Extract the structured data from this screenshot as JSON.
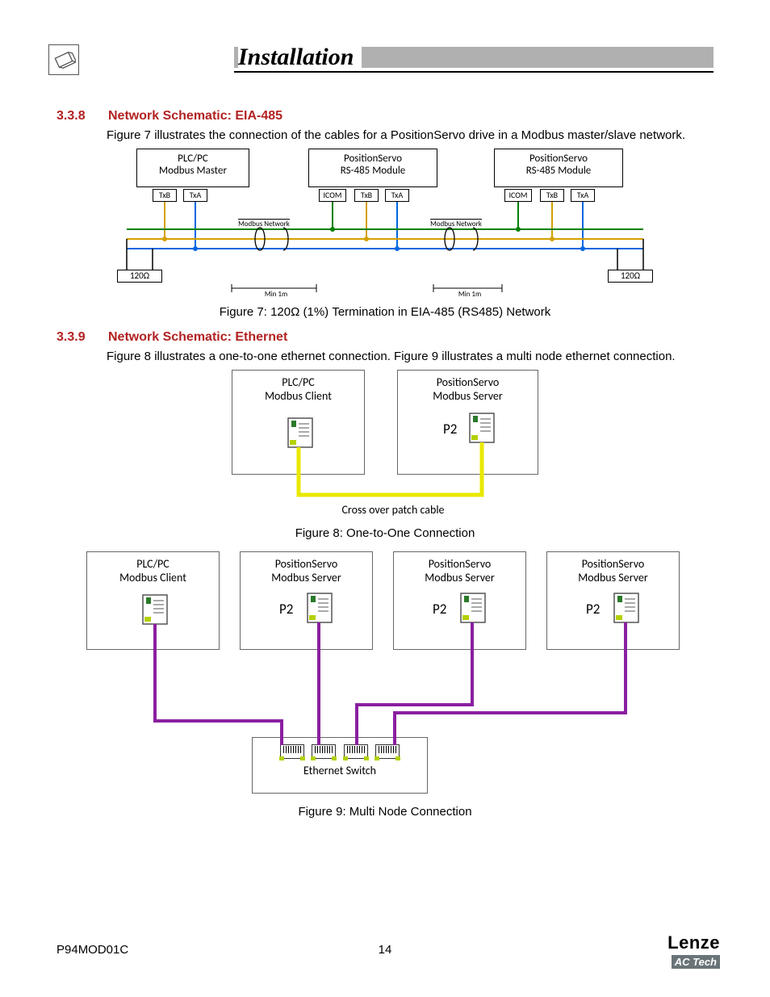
{
  "chapter_title": "Installation",
  "section_338": {
    "num": "3.3.8",
    "title": "Network Schematic: EIA-485",
    "text": "Figure 7 illustrates the connection of the cables for a PositionServo drive in a Modbus master/slave network."
  },
  "section_339": {
    "num": "3.3.9",
    "title": "Network Schematic: Ethernet",
    "text": "Figure 8 illustrates a one-to-one ethernet connection. Figure 9 illustrates a multi node ethernet connection."
  },
  "fig7": {
    "caption": "Figure 7: 120Ω (1%) Termination in EIA-485 (RS485) Network",
    "master": {
      "line1": "PLC/PC",
      "line2": "Modbus Master",
      "pins": [
        "TxB",
        "TxA"
      ]
    },
    "node": {
      "line1": "PositionServo",
      "line2": "RS-485 Module",
      "pins": [
        "ICOM",
        "TxB",
        "TxA"
      ]
    },
    "term": "120Ω",
    "bus_label": "Modbus Network",
    "min_label": "Min 1m"
  },
  "fig8": {
    "caption": "Figure 8: One-to-One Connection",
    "client": {
      "line1": "PLC/PC",
      "line2": "Modbus Client"
    },
    "server": {
      "line1": "PositionServo",
      "line2": "Modbus Server",
      "port": "P2"
    },
    "cable_label": "Cross over patch cable"
  },
  "fig9": {
    "caption": "Figure 9: Multi Node Connection",
    "client": {
      "line1": "PLC/PC",
      "line2": "Modbus Client"
    },
    "server": {
      "line1": "PositionServo",
      "line2": "Modbus Server",
      "port": "P2"
    },
    "switch_label": "Ethernet Switch"
  },
  "footer": {
    "doc": "P94MOD01C",
    "page": "14",
    "brand": "Lenze",
    "sub": "AC Tech"
  }
}
